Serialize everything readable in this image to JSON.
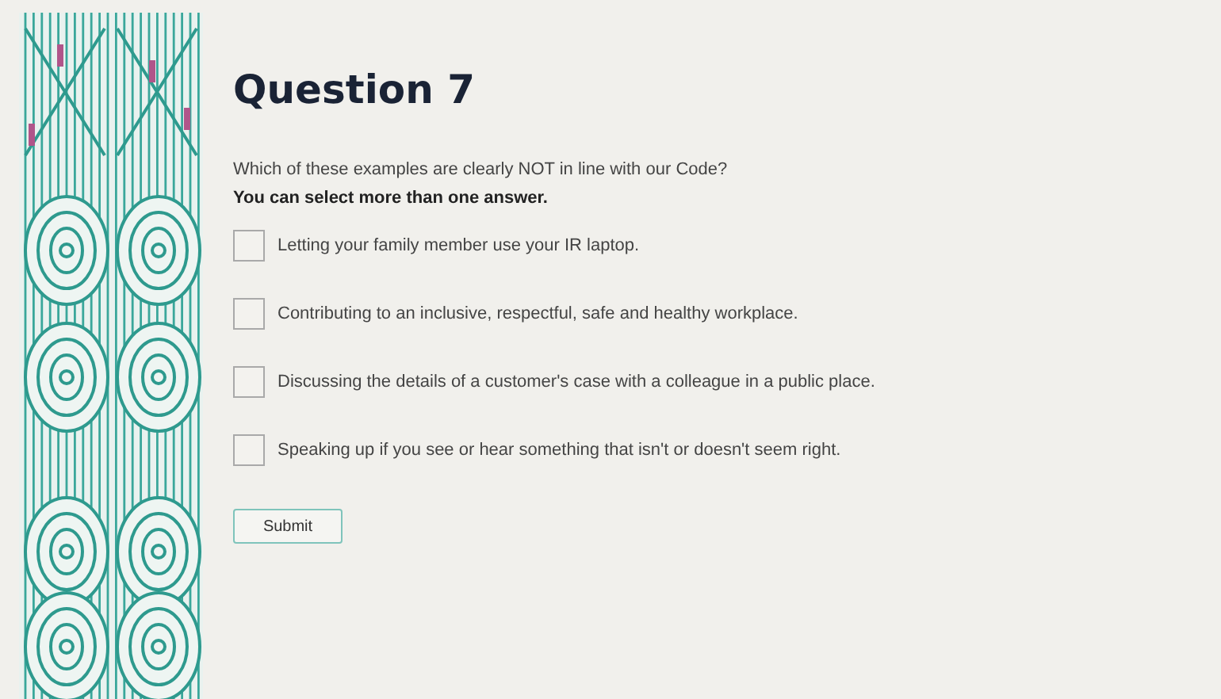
{
  "question": {
    "title": "Question 7",
    "prompt": "Which of these examples are clearly NOT in line with our Code?",
    "instruction": "You can select more than one answer."
  },
  "answers": [
    {
      "label": "Letting your family member use your IR laptop.",
      "checked": false
    },
    {
      "label": "Contributing to an inclusive, respectful, safe and healthy workplace.",
      "checked": false
    },
    {
      "label": "Discussing the details of a customer's case with a colleague in a public place.",
      "checked": false
    },
    {
      "label": "Speaking up if you see or hear something that isn't or doesn't seem right.",
      "checked": false
    }
  ],
  "submit": "Submit"
}
